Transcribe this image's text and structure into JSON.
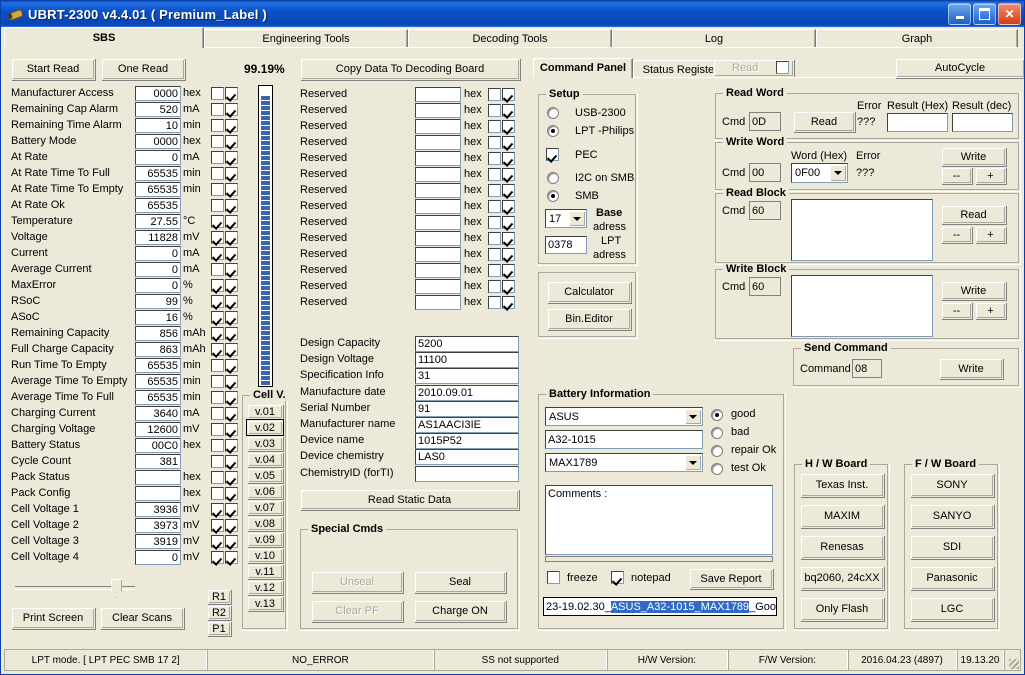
{
  "window": {
    "title": "UBRT-2300 v4.4.01  ( Premium_Label )",
    "minimize": "_",
    "maximize": "□",
    "close": "✕"
  },
  "tabs": [
    {
      "label": "SBS",
      "active": true
    },
    {
      "label": "Engineering Tools",
      "active": false
    },
    {
      "label": "Decoding Tools",
      "active": false
    },
    {
      "label": "Log",
      "active": false
    },
    {
      "label": "Graph",
      "active": false
    }
  ],
  "toolbar": {
    "start_read": "Start Read",
    "one_read": "One Read",
    "percent": "99.19%",
    "copy_data": "Copy Data To Decoding Board",
    "read_disabled": "Read",
    "autocycle": "AutoCycle"
  },
  "subtabs": [
    {
      "label": "Command Panel",
      "active": true
    },
    {
      "label": "Status Registers",
      "active": false
    }
  ],
  "sbs": {
    "rows": [
      {
        "label": "Manufacturer Access",
        "value": "0000",
        "unit": "hex",
        "c1": false,
        "c2": true
      },
      {
        "label": "Remaining Cap Alarm",
        "value": "520",
        "unit": "mA",
        "c1": false,
        "c2": true
      },
      {
        "label": "Remaining Time Alarm",
        "value": "10",
        "unit": "min",
        "c1": false,
        "c2": true
      },
      {
        "label": "Battery Mode",
        "value": "0000",
        "unit": "hex",
        "c1": false,
        "c2": true
      },
      {
        "label": "At Rate",
        "value": "0",
        "unit": "mA",
        "c1": false,
        "c2": true
      },
      {
        "label": "At Rate Time To Full",
        "value": "65535",
        "unit": "min",
        "c1": false,
        "c2": true
      },
      {
        "label": "At Rate Time To Empty",
        "value": "65535",
        "unit": "min",
        "c1": false,
        "c2": true
      },
      {
        "label": "At Rate Ok",
        "value": "65535",
        "unit": "",
        "c1": false,
        "c2": true
      },
      {
        "label": "Temperature",
        "value": "27.55",
        "unit": "°C",
        "c1": true,
        "c2": true
      },
      {
        "label": "Voltage",
        "value": "11828",
        "unit": "mV",
        "c1": true,
        "c2": true
      },
      {
        "label": "Current",
        "value": "0",
        "unit": "mA",
        "c1": true,
        "c2": true
      },
      {
        "label": "Average Current",
        "value": "0",
        "unit": "mA",
        "c1": false,
        "c2": true
      },
      {
        "label": "MaxError",
        "value": "0",
        "unit": "%",
        "c1": true,
        "c2": true
      },
      {
        "label": "RSoC",
        "value": "99",
        "unit": "%",
        "c1": true,
        "c2": true
      },
      {
        "label": "ASoC",
        "value": "16",
        "unit": "%",
        "c1": true,
        "c2": true
      },
      {
        "label": "Remaining Capacity",
        "value": "856",
        "unit": "mAh",
        "c1": true,
        "c2": true
      },
      {
        "label": "Full Charge Capacity",
        "value": "863",
        "unit": "mAh",
        "c1": true,
        "c2": true
      },
      {
        "label": "Run Time To Empty",
        "value": "65535",
        "unit": "min",
        "c1": false,
        "c2": true
      },
      {
        "label": "Average Time To Empty",
        "value": "65535",
        "unit": "min",
        "c1": false,
        "c2": true
      },
      {
        "label": "Average Time To Full",
        "value": "65535",
        "unit": "min",
        "c1": false,
        "c2": true
      },
      {
        "label": "Charging Current",
        "value": "3640",
        "unit": "mA",
        "c1": false,
        "c2": true
      },
      {
        "label": "Charging Voltage",
        "value": "12600",
        "unit": "mV",
        "c1": false,
        "c2": true
      },
      {
        "label": "Battery Status",
        "value": "00C0",
        "unit": "hex",
        "c1": false,
        "c2": true
      },
      {
        "label": "Cycle Count",
        "value": "381",
        "unit": "",
        "c1": false,
        "c2": true
      },
      {
        "label": "Pack Status",
        "value": "",
        "unit": "hex",
        "c1": false,
        "c2": true
      },
      {
        "label": "Pack Config",
        "value": "",
        "unit": "hex",
        "c1": false,
        "c2": true
      },
      {
        "label": "Cell Voltage 1",
        "value": "3936",
        "unit": "mV",
        "c1": true,
        "c2": true
      },
      {
        "label": "Cell Voltage 2",
        "value": "3973",
        "unit": "mV",
        "c1": true,
        "c2": true
      },
      {
        "label": "Cell Voltage 3",
        "value": "3919",
        "unit": "mV",
        "c1": true,
        "c2": true
      },
      {
        "label": "Cell Voltage 4",
        "value": "0",
        "unit": "mV",
        "c1": true,
        "c2": true
      }
    ],
    "print_screen": "Print Screen",
    "clear_scans": "Clear Scans",
    "side_buttons": [
      "R1",
      "R2",
      "P1"
    ]
  },
  "reserved": {
    "rows": [
      {
        "label": "Reserved",
        "value": "",
        "unit": "hex",
        "c1": false,
        "c2": true
      },
      {
        "label": "Reserved",
        "value": "",
        "unit": "hex",
        "c1": false,
        "c2": true
      },
      {
        "label": "Reserved",
        "value": "",
        "unit": "hex",
        "c1": false,
        "c2": true
      },
      {
        "label": "Reserved",
        "value": "",
        "unit": "hex",
        "c1": false,
        "c2": true
      },
      {
        "label": "Reserved",
        "value": "",
        "unit": "hex",
        "c1": false,
        "c2": true
      },
      {
        "label": "Reserved",
        "value": "",
        "unit": "hex",
        "c1": false,
        "c2": true
      },
      {
        "label": "Reserved",
        "value": "",
        "unit": "hex",
        "c1": false,
        "c2": true
      },
      {
        "label": "Reserved",
        "value": "",
        "unit": "hex",
        "c1": false,
        "c2": true
      },
      {
        "label": "Reserved",
        "value": "",
        "unit": "hex",
        "c1": false,
        "c2": true
      },
      {
        "label": "Reserved",
        "value": "",
        "unit": "hex",
        "c1": false,
        "c2": true
      },
      {
        "label": "Reserved",
        "value": "",
        "unit": "hex",
        "c1": false,
        "c2": true
      },
      {
        "label": "Reserved",
        "value": "",
        "unit": "hex",
        "c1": false,
        "c2": true
      },
      {
        "label": "Reserved",
        "value": "",
        "unit": "hex",
        "c1": false,
        "c2": true
      },
      {
        "label": "Reserved",
        "value": "",
        "unit": "hex",
        "c1": false,
        "c2": true
      }
    ]
  },
  "cellv": {
    "title": "Cell V.",
    "buttons": [
      "v.01",
      "v.02",
      "v.03",
      "v.04",
      "v.05",
      "v.06",
      "v.07",
      "v.08",
      "v.09",
      "v.10",
      "v.11",
      "v.12",
      "v.13"
    ],
    "selected": "v.02"
  },
  "static": {
    "rows": [
      {
        "label": "Design Capacity",
        "value": "5200"
      },
      {
        "label": "Design Voltage",
        "value": "11100"
      },
      {
        "label": "Specification Info",
        "value": "31"
      },
      {
        "label": "Manufacture date",
        "value": "2010.09.01"
      },
      {
        "label": "Serial Number",
        "value": "91"
      },
      {
        "label": "Manufacturer name",
        "value": "AS1AACI3IE"
      },
      {
        "label": "Device name",
        "value": "1015P52"
      },
      {
        "label": "Device chemistry",
        "value": "LAS0"
      },
      {
        "label": "ChemistryID (forTI)",
        "value": ""
      }
    ],
    "read_static": "Read Static Data"
  },
  "special": {
    "title": "Special Cmds",
    "unseal": "Unseal",
    "seal": "Seal",
    "clear_pf": "Clear PF",
    "charge_on": "Charge ON"
  },
  "setup": {
    "title": "Setup",
    "usb": {
      "label": "USB-2300",
      "checked": false
    },
    "lpt": {
      "label": "LPT -Philips",
      "checked": true
    },
    "pec": {
      "label": "PEC",
      "checked": true
    },
    "i2c": {
      "label": "I2C on SMB",
      "checked": false
    },
    "smb": {
      "label": "SMB",
      "checked": true
    },
    "base_value": "17",
    "base_label_1": "Base",
    "base_label_2": "adress",
    "lpt_value": "0378",
    "lpt_label_1": "LPT",
    "lpt_label_2": "adress",
    "calculator": "Calculator",
    "bin_editor": "Bin.Editor"
  },
  "read_word": {
    "title": "Read Word",
    "cmd_label": "Cmd",
    "cmd_value": "0D",
    "read_btn": "Read",
    "error_label": "Error",
    "error_value": "???",
    "hex_label": "Result (Hex)",
    "hex_value": "",
    "dec_label": "Result (dec)",
    "dec_value": ""
  },
  "write_word": {
    "title": "Write Word",
    "cmd_label": "Cmd",
    "cmd_value": "00",
    "word_label": "Word (Hex)",
    "word_value": "0F00",
    "error_label": "Error",
    "error_value": "???",
    "write_btn": "Write",
    "minus": "--",
    "plus": "+"
  },
  "read_block": {
    "title": "Read Block",
    "cmd_label": "Cmd",
    "cmd_value": "60",
    "content": "",
    "read_btn": "Read",
    "minus": "--",
    "plus": "+"
  },
  "write_block": {
    "title": "Write Block",
    "cmd_label": "Cmd",
    "cmd_value": "60",
    "content": "",
    "write_btn": "Write",
    "minus": "--",
    "plus": "+"
  },
  "send_command": {
    "title": "Send Command",
    "cmd_label": "Command",
    "cmd_value": "08",
    "write_btn": "Write"
  },
  "battery_info": {
    "title": "Battery Information",
    "brand": "ASUS",
    "model": "A32-1015",
    "ic": "MAX1789",
    "states": [
      {
        "label": "good",
        "checked": true
      },
      {
        "label": "bad",
        "checked": false
      },
      {
        "label": "repair Ok",
        "checked": false
      },
      {
        "label": "test   Ok",
        "checked": false
      }
    ],
    "comments": "Comments :",
    "freeze": {
      "label": "freeze",
      "checked": false
    },
    "notepad": {
      "label": "notepad",
      "checked": true
    },
    "save_report": "Save Report",
    "filename_pre": "23-19.02.30_",
    "filename_sel": "ASUS_A32-1015_MAX1789",
    "filename_post": "_Good"
  },
  "hw_board": {
    "title": "H / W   Board",
    "buttons": [
      "Texas Inst.",
      "MAXIM",
      "Renesas",
      "bq2060, 24cXX",
      "Only Flash"
    ]
  },
  "fw_board": {
    "title": "F / W   Board",
    "buttons": [
      "SONY",
      "SANYO",
      "SDI",
      "Panasonic",
      "LGC"
    ]
  },
  "statusbar": {
    "cells": [
      "LPT mode. [ LPT  PEC  SMB  17 2]",
      "NO_ERROR",
      "SS not supported",
      "H/W Version:",
      "F/W Version:",
      "2016.04.23 (4897)",
      "19.13.20"
    ]
  }
}
